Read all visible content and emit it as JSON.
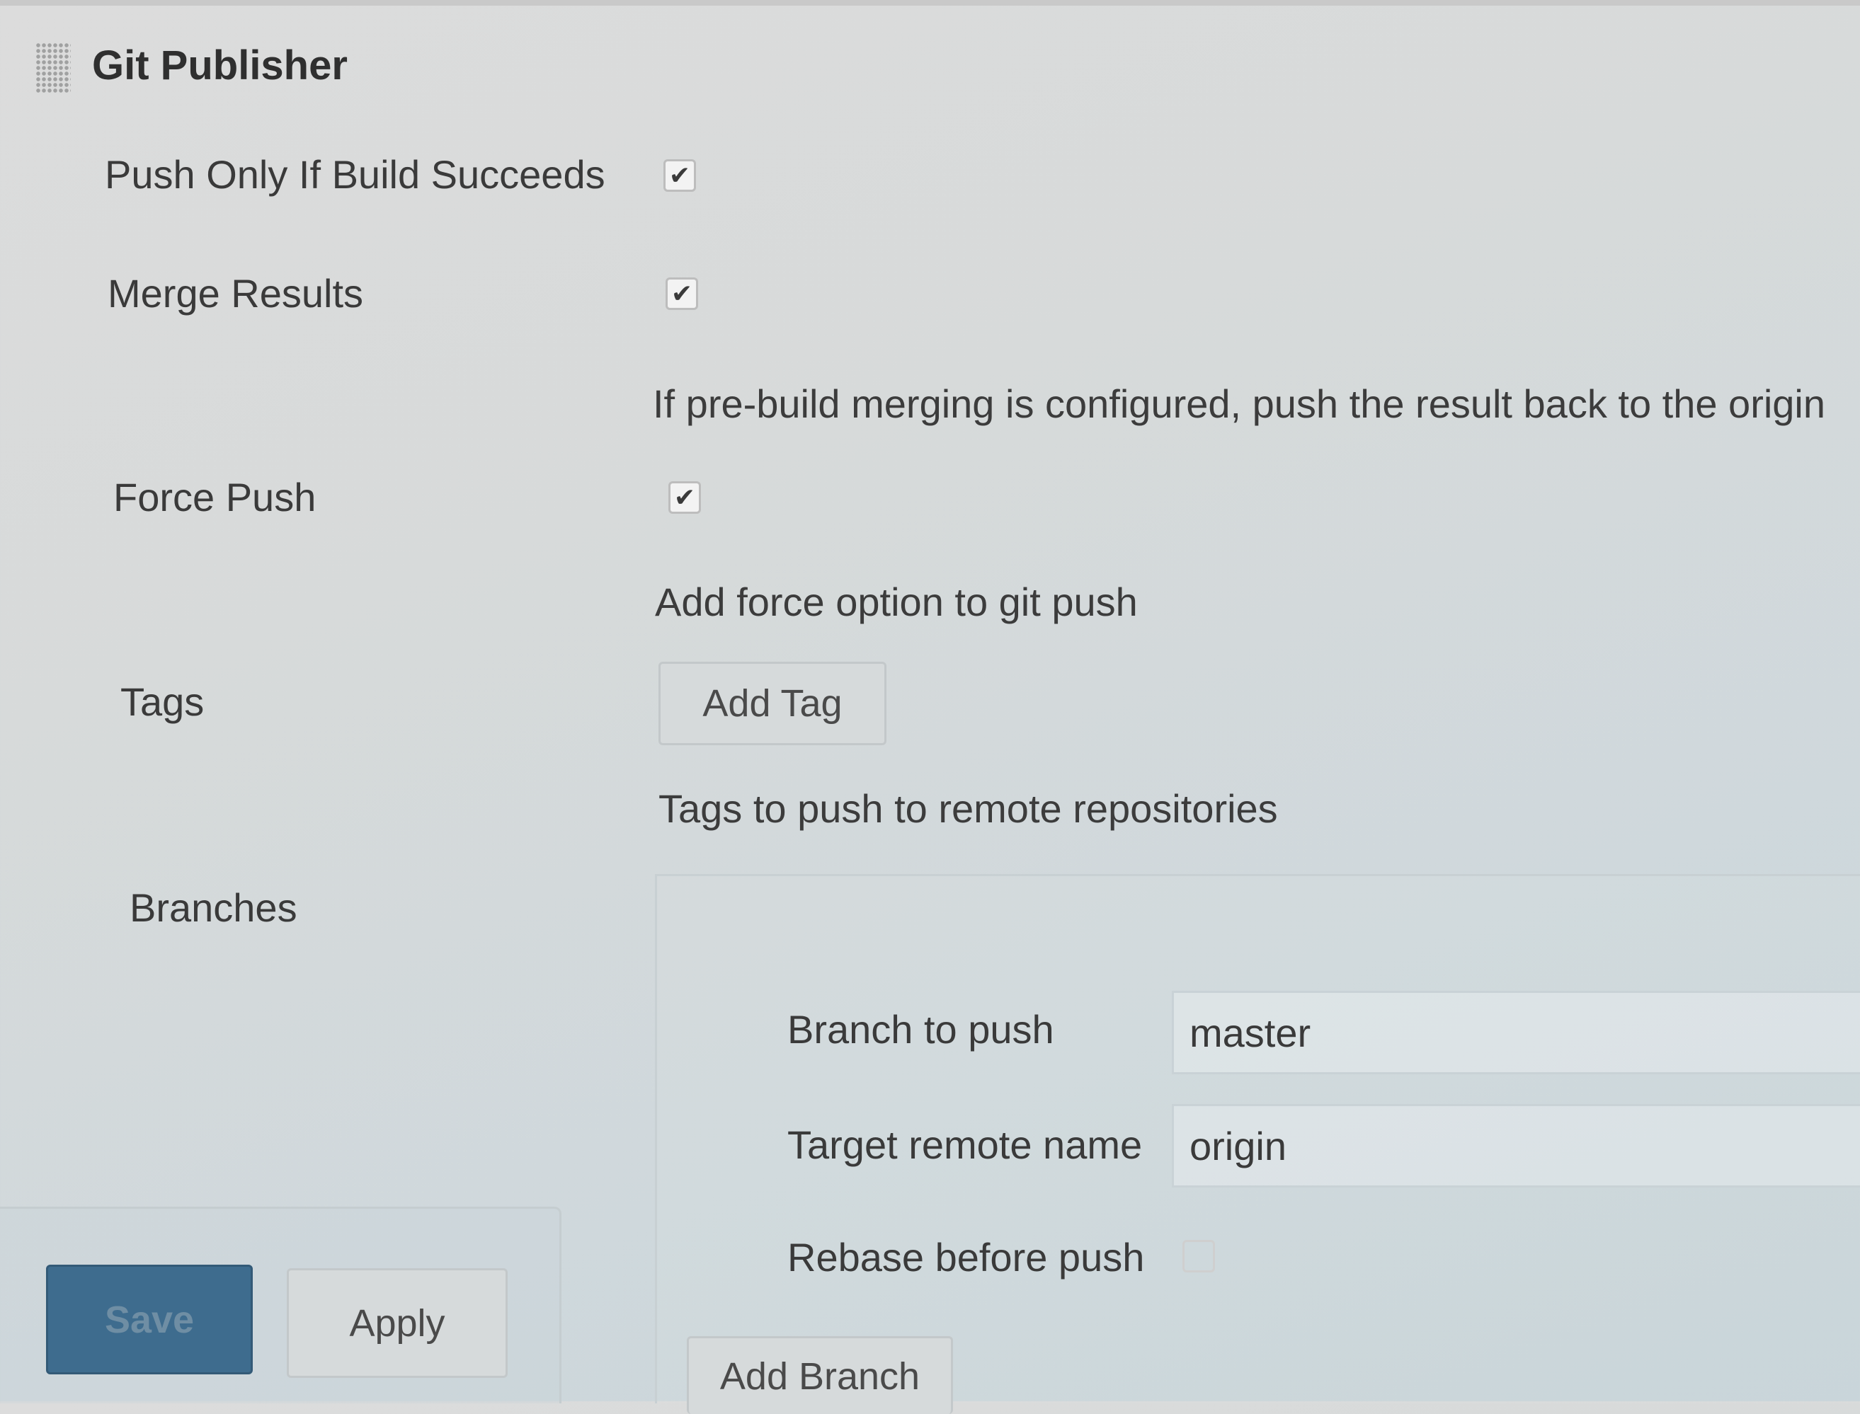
{
  "section": {
    "title": "Git Publisher"
  },
  "options": {
    "push_only_if_build_succeeds": {
      "label": "Push Only If Build Succeeds",
      "checked": true
    },
    "merge_results": {
      "label": "Merge Results",
      "checked": true,
      "description": "If pre-build merging is configured, push the result back to the origin"
    },
    "force_push": {
      "label": "Force Push",
      "checked": true,
      "description": "Add force option to git push"
    },
    "tags": {
      "label": "Tags",
      "add_button": "Add Tag",
      "description": "Tags to push to remote repositories"
    },
    "branches": {
      "label": "Branches",
      "branch_to_push_label": "Branch to push",
      "branch_to_push_value": "master",
      "target_remote_label": "Target remote name",
      "target_remote_value": "origin",
      "rebase_label": "Rebase before push",
      "rebase_checked": false,
      "add_button": "Add Branch"
    }
  },
  "footer": {
    "save_label": "Save",
    "apply_label": "Apply"
  },
  "icons": {
    "check_glyph": "✔"
  },
  "colors": {
    "primary_button": "#3e6c8e"
  }
}
